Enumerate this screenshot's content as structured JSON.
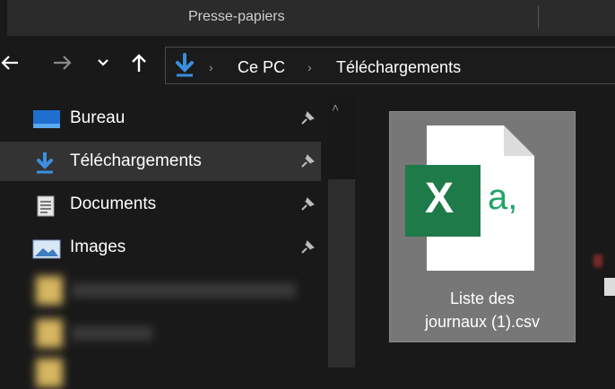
{
  "ribbon": {
    "label": "Presse-papiers"
  },
  "nav": {
    "back_icon": "back-arrow-icon",
    "forward_icon": "forward-arrow-icon",
    "recent_icon": "chevron-down-icon",
    "up_icon": "up-arrow-icon"
  },
  "address": {
    "location_icon": "download-arrow-icon",
    "parts": [
      "Ce PC",
      "Téléchargements"
    ],
    "separator": "›"
  },
  "sidebar": {
    "scroll_up": "˄",
    "items": [
      {
        "label": "Bureau",
        "icon": "desktop-icon",
        "pinned": true,
        "selected": false
      },
      {
        "label": "Téléchargements",
        "icon": "download-icon",
        "pinned": true,
        "selected": true
      },
      {
        "label": "Documents",
        "icon": "document-icon",
        "pinned": true,
        "selected": false
      },
      {
        "label": "Images",
        "icon": "images-icon",
        "pinned": true,
        "selected": false
      }
    ]
  },
  "content": {
    "file": {
      "name": "Liste des\njournaux (1).csv",
      "icon": "excel-csv-icon",
      "badge": "X",
      "glyph": "a,"
    }
  },
  "colors": {
    "background": "#191919",
    "selected_item": "#333333",
    "selected_tile": "#777777",
    "excel_green": "#1f7a4a",
    "accent_blue": "#3a8fe0"
  }
}
